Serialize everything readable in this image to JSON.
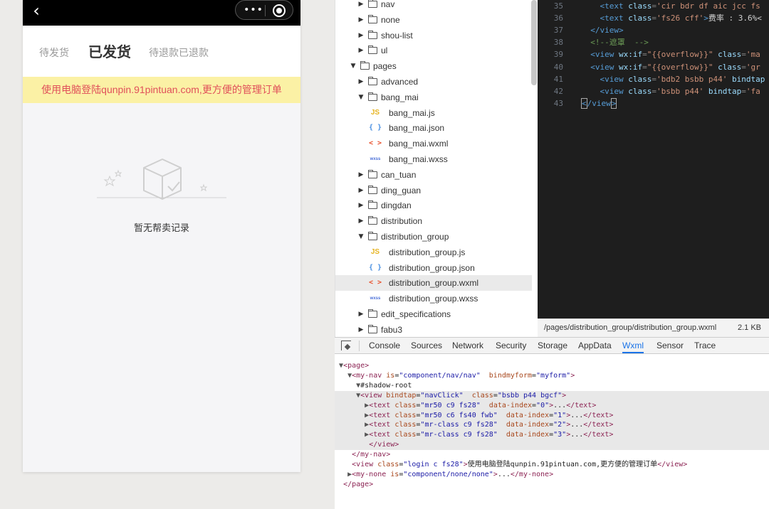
{
  "simulator": {
    "back_glyph": "‹",
    "capsule_dots": "•••",
    "tabs": [
      "待发货",
      "已发货",
      "待退款已退款"
    ],
    "banner": "使用电脑登陆qunpin.91pintuan.com,更方便的管理订单",
    "empty_text": "暂无帮卖记录"
  },
  "file_tree": {
    "rows": [
      {
        "type": "folder",
        "expanded": false,
        "indent": 1,
        "label": "nav"
      },
      {
        "type": "folder",
        "expanded": false,
        "indent": 1,
        "label": "none"
      },
      {
        "type": "folder",
        "expanded": false,
        "indent": 1,
        "label": "shou-list"
      },
      {
        "type": "folder",
        "expanded": false,
        "indent": 1,
        "label": "ul"
      },
      {
        "type": "folder",
        "expanded": true,
        "indent": 0,
        "label": "pages"
      },
      {
        "type": "folder",
        "expanded": false,
        "indent": 1,
        "label": "advanced"
      },
      {
        "type": "folder",
        "expanded": true,
        "indent": 1,
        "label": "bang_mai"
      },
      {
        "type": "file",
        "ext": "js",
        "icon": "JS",
        "indent": 2,
        "label": "bang_mai.js"
      },
      {
        "type": "file",
        "ext": "json",
        "icon": "{ }",
        "indent": 2,
        "label": "bang_mai.json"
      },
      {
        "type": "file",
        "ext": "wxml",
        "icon": "< >",
        "indent": 2,
        "label": "bang_mai.wxml"
      },
      {
        "type": "file",
        "ext": "wxss",
        "icon": "wxss",
        "indent": 2,
        "label": "bang_mai.wxss"
      },
      {
        "type": "folder",
        "expanded": false,
        "indent": 1,
        "label": "can_tuan"
      },
      {
        "type": "folder",
        "expanded": false,
        "indent": 1,
        "label": "ding_guan"
      },
      {
        "type": "folder",
        "expanded": false,
        "indent": 1,
        "label": "dingdan"
      },
      {
        "type": "folder",
        "expanded": false,
        "indent": 1,
        "label": "distribution"
      },
      {
        "type": "folder",
        "expanded": true,
        "indent": 1,
        "label": "distribution_group"
      },
      {
        "type": "file",
        "ext": "js",
        "icon": "JS",
        "indent": 2,
        "label": "distribution_group.js"
      },
      {
        "type": "file",
        "ext": "json",
        "icon": "{ }",
        "indent": 2,
        "label": "distribution_group.json"
      },
      {
        "type": "file",
        "ext": "wxml",
        "icon": "< >",
        "indent": 2,
        "label": "distribution_group.wxml",
        "selected": true
      },
      {
        "type": "file",
        "ext": "wxss",
        "icon": "wxss",
        "indent": 2,
        "label": "distribution_group.wxss"
      },
      {
        "type": "folder",
        "expanded": false,
        "indent": 1,
        "label": "edit_specifications"
      },
      {
        "type": "folder",
        "expanded": false,
        "indent": 1,
        "label": "fabu3"
      }
    ]
  },
  "editor": {
    "lines": [
      {
        "n": "35",
        "tokens": [
          [
            "t",
            "    "
          ],
          [
            "tag",
            "<text "
          ],
          [
            "attr",
            "class"
          ],
          [
            "punc",
            "="
          ],
          [
            "str",
            "'cir bdr df aic jcc fs"
          ]
        ]
      },
      {
        "n": "36",
        "tokens": [
          [
            "t",
            "    "
          ],
          [
            "tag",
            "<text "
          ],
          [
            "attr",
            "class"
          ],
          [
            "punc",
            "="
          ],
          [
            "str",
            "'fs26 cff'"
          ],
          [
            "tag",
            ">"
          ],
          [
            "t",
            "费率 : 3.6%<"
          ]
        ]
      },
      {
        "n": "37",
        "tokens": [
          [
            "t",
            "  "
          ],
          [
            "tag",
            "</view>"
          ]
        ]
      },
      {
        "n": "38",
        "tokens": [
          [
            "t",
            "  "
          ],
          [
            "cmt",
            "<!--遮罩  -->"
          ]
        ]
      },
      {
        "n": "39",
        "tokens": [
          [
            "t",
            "  "
          ],
          [
            "tag",
            "<view "
          ],
          [
            "attr",
            "wx:if"
          ],
          [
            "punc",
            "="
          ],
          [
            "str",
            "\"{{overflow}}\""
          ],
          [
            "t",
            " "
          ],
          [
            "attr",
            "class"
          ],
          [
            "punc",
            "="
          ],
          [
            "str",
            "'ma"
          ]
        ]
      },
      {
        "n": "40",
        "tokens": [
          [
            "t",
            "  "
          ],
          [
            "tag",
            "<view "
          ],
          [
            "attr",
            "wx:if"
          ],
          [
            "punc",
            "="
          ],
          [
            "str",
            "\"{{overflow}}\""
          ],
          [
            "t",
            " "
          ],
          [
            "attr",
            "class"
          ],
          [
            "punc",
            "="
          ],
          [
            "str",
            "'gr"
          ]
        ]
      },
      {
        "n": "41",
        "tokens": [
          [
            "t",
            "    "
          ],
          [
            "tag",
            "<view "
          ],
          [
            "attr",
            "class"
          ],
          [
            "punc",
            "="
          ],
          [
            "str",
            "'bdb2 bsbb p44'"
          ],
          [
            "t",
            " "
          ],
          [
            "attr",
            "bindtap"
          ]
        ]
      },
      {
        "n": "42",
        "tokens": [
          [
            "t",
            "    "
          ],
          [
            "tag",
            "<view "
          ],
          [
            "attr",
            "class"
          ],
          [
            "punc",
            "="
          ],
          [
            "str",
            "'bsbb p44'"
          ],
          [
            "t",
            " "
          ],
          [
            "attr",
            "bindtap"
          ],
          [
            "punc",
            "="
          ],
          [
            "str",
            "'fa"
          ]
        ]
      },
      {
        "n": "43",
        "tokens": [
          [
            "cursor",
            "<"
          ],
          [
            "tag",
            "/view"
          ],
          [
            "cursor",
            ">"
          ]
        ]
      }
    ],
    "status_path": "/pages/distribution_group/distribution_group.wxml",
    "status_size": "2.1 KB"
  },
  "panel_tabs": {
    "items": [
      "Console",
      "Sources",
      "Network",
      "Security",
      "Storage",
      "AppData",
      "Wxml",
      "Sensor",
      "Trace"
    ],
    "active": "Wxml"
  },
  "wxml": {
    "rows": [
      {
        "indent": 0,
        "arrow": "▼",
        "parts": [
          [
            "tag",
            "<page>"
          ]
        ]
      },
      {
        "indent": 1,
        "arrow": "▼",
        "parts": [
          [
            "tag",
            "<my-nav "
          ],
          [
            "attr",
            "is"
          ],
          [
            "txt",
            "="
          ],
          [
            "val",
            "\"component/nav/nav\""
          ],
          [
            "txt",
            "  "
          ],
          [
            "attr",
            "bindmyform"
          ],
          [
            "txt",
            "="
          ],
          [
            "val",
            "\"myform\""
          ],
          [
            "tag",
            ">"
          ]
        ]
      },
      {
        "indent": 2,
        "arrow": "▼",
        "parts": [
          [
            "txt",
            "#shadow-root"
          ]
        ]
      },
      {
        "indent": 2,
        "arrow": "▼",
        "hl": true,
        "parts": [
          [
            "tag",
            "<view "
          ],
          [
            "attr",
            "bindtap"
          ],
          [
            "txt",
            "="
          ],
          [
            "val",
            "\"navClick\""
          ],
          [
            "txt",
            "  "
          ],
          [
            "attr",
            "class"
          ],
          [
            "txt",
            "="
          ],
          [
            "val",
            "\"bsbb p44 bgcf\""
          ],
          [
            "tag",
            ">"
          ]
        ]
      },
      {
        "indent": 3,
        "arrow": "▶",
        "hl": true,
        "parts": [
          [
            "tag",
            "<text "
          ],
          [
            "attr",
            "class"
          ],
          [
            "txt",
            "="
          ],
          [
            "val",
            "\"mr50 c9 fs28\""
          ],
          [
            "txt",
            "  "
          ],
          [
            "attr",
            "data-index"
          ],
          [
            "txt",
            "="
          ],
          [
            "val",
            "\"0\""
          ],
          [
            "tag",
            ">"
          ],
          [
            "txt",
            "..."
          ],
          [
            "tag",
            "</text>"
          ]
        ]
      },
      {
        "indent": 3,
        "arrow": "▶",
        "hl": true,
        "parts": [
          [
            "tag",
            "<text "
          ],
          [
            "attr",
            "class"
          ],
          [
            "txt",
            "="
          ],
          [
            "val",
            "\"mr50 c6 fs40 fwb\""
          ],
          [
            "txt",
            "  "
          ],
          [
            "attr",
            "data-index"
          ],
          [
            "txt",
            "="
          ],
          [
            "val",
            "\"1\""
          ],
          [
            "tag",
            ">"
          ],
          [
            "txt",
            "..."
          ],
          [
            "tag",
            "</text>"
          ]
        ]
      },
      {
        "indent": 3,
        "arrow": "▶",
        "hl": true,
        "parts": [
          [
            "tag",
            "<text "
          ],
          [
            "attr",
            "class"
          ],
          [
            "txt",
            "="
          ],
          [
            "val",
            "\"mr-class c9 fs28\""
          ],
          [
            "txt",
            "  "
          ],
          [
            "attr",
            "data-index"
          ],
          [
            "txt",
            "="
          ],
          [
            "val",
            "\"2\""
          ],
          [
            "tag",
            ">"
          ],
          [
            "txt",
            "..."
          ],
          [
            "tag",
            "</text>"
          ]
        ]
      },
      {
        "indent": 3,
        "arrow": "▶",
        "hl": true,
        "parts": [
          [
            "tag",
            "<text "
          ],
          [
            "attr",
            "class"
          ],
          [
            "txt",
            "="
          ],
          [
            "val",
            "\"mr-class c9 fs28\""
          ],
          [
            "txt",
            "  "
          ],
          [
            "attr",
            "data-index"
          ],
          [
            "txt",
            "="
          ],
          [
            "val",
            "\"3\""
          ],
          [
            "tag",
            ">"
          ],
          [
            "txt",
            "..."
          ],
          [
            "tag",
            "</text>"
          ]
        ]
      },
      {
        "indent": 3,
        "arrow": "",
        "hl": true,
        "parts": [
          [
            "tag",
            "</view>"
          ]
        ]
      },
      {
        "indent": 1,
        "arrow": "",
        "parts": [
          [
            "tag",
            "</my-nav>"
          ]
        ]
      },
      {
        "indent": 1,
        "arrow": "",
        "parts": [
          [
            "tag",
            "<view "
          ],
          [
            "attr",
            "class"
          ],
          [
            "txt",
            "="
          ],
          [
            "val",
            "\"login c fs28\""
          ],
          [
            "tag",
            ">"
          ],
          [
            "txt",
            "使用电脑登陆qunpin.91pintuan.com,更方便的管理订单"
          ],
          [
            "tag",
            "</view>"
          ]
        ]
      },
      {
        "indent": 1,
        "arrow": "▶",
        "parts": [
          [
            "tag",
            "<my-none "
          ],
          [
            "attr",
            "is"
          ],
          [
            "txt",
            "="
          ],
          [
            "val",
            "\"component/none/none\""
          ],
          [
            "tag",
            ">"
          ],
          [
            "txt",
            "..."
          ],
          [
            "tag",
            "</my-none>"
          ]
        ]
      },
      {
        "indent": 0,
        "arrow": "",
        "parts": [
          [
            "tag",
            "</page>"
          ]
        ]
      }
    ]
  }
}
